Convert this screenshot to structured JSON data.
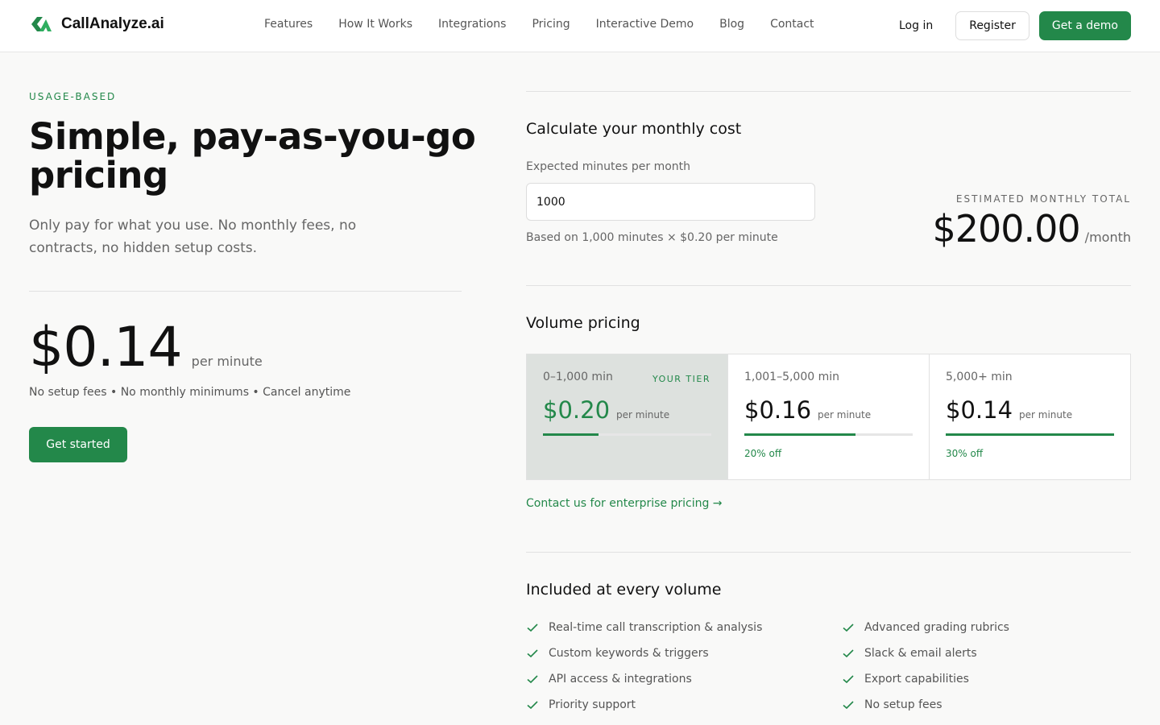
{
  "brand": {
    "name": "CallAnalyze.ai",
    "accent": "#23884a"
  },
  "nav": {
    "items": [
      "Features",
      "How It Works",
      "Integrations",
      "Pricing",
      "Interactive Demo",
      "Blog",
      "Contact"
    ],
    "login": "Log in",
    "register": "Register",
    "demo": "Get a demo"
  },
  "hero": {
    "eyebrow": "USAGE-BASED",
    "title": "Simple, pay-as-you-go pricing",
    "subtitle": "Only pay for what you use. No monthly fees, no contracts, no hidden setup costs.",
    "price": "$0.14",
    "price_unit": "per minute",
    "features": "No setup fees • No monthly minimums • Cancel anytime",
    "cta": "Get started"
  },
  "calculator": {
    "title": "Calculate your monthly cost",
    "input_label": "Expected minutes per month",
    "input_value": "1000",
    "note": "Based on 1,000 minutes × $0.20 per minute",
    "estimate_label": "ESTIMATED MONTHLY TOTAL",
    "estimate_value": "$200.00",
    "estimate_unit": "/month"
  },
  "volume": {
    "title": "Volume pricing",
    "tiers": [
      {
        "range": "0–1,000 min",
        "badge": "YOUR TIER",
        "price": "$0.20",
        "unit": "per minute",
        "discount": "",
        "fill": 0.33
      },
      {
        "range": "1,001–5,000 min",
        "badge": "",
        "price": "$0.16",
        "unit": "per minute",
        "discount": "20% off",
        "fill": 0.66
      },
      {
        "range": "5,000+ min",
        "badge": "",
        "price": "$0.14",
        "unit": "per minute",
        "discount": "30% off",
        "fill": 1.0
      }
    ],
    "enterprise_link": "Contact us for enterprise pricing →"
  },
  "included": {
    "title": "Included at every volume",
    "items": [
      "Real-time call transcription & analysis",
      "Advanced grading rubrics",
      "Custom keywords & triggers",
      "Slack & email alerts",
      "API access & integrations",
      "Export capabilities",
      "Priority support",
      "No setup fees"
    ]
  }
}
